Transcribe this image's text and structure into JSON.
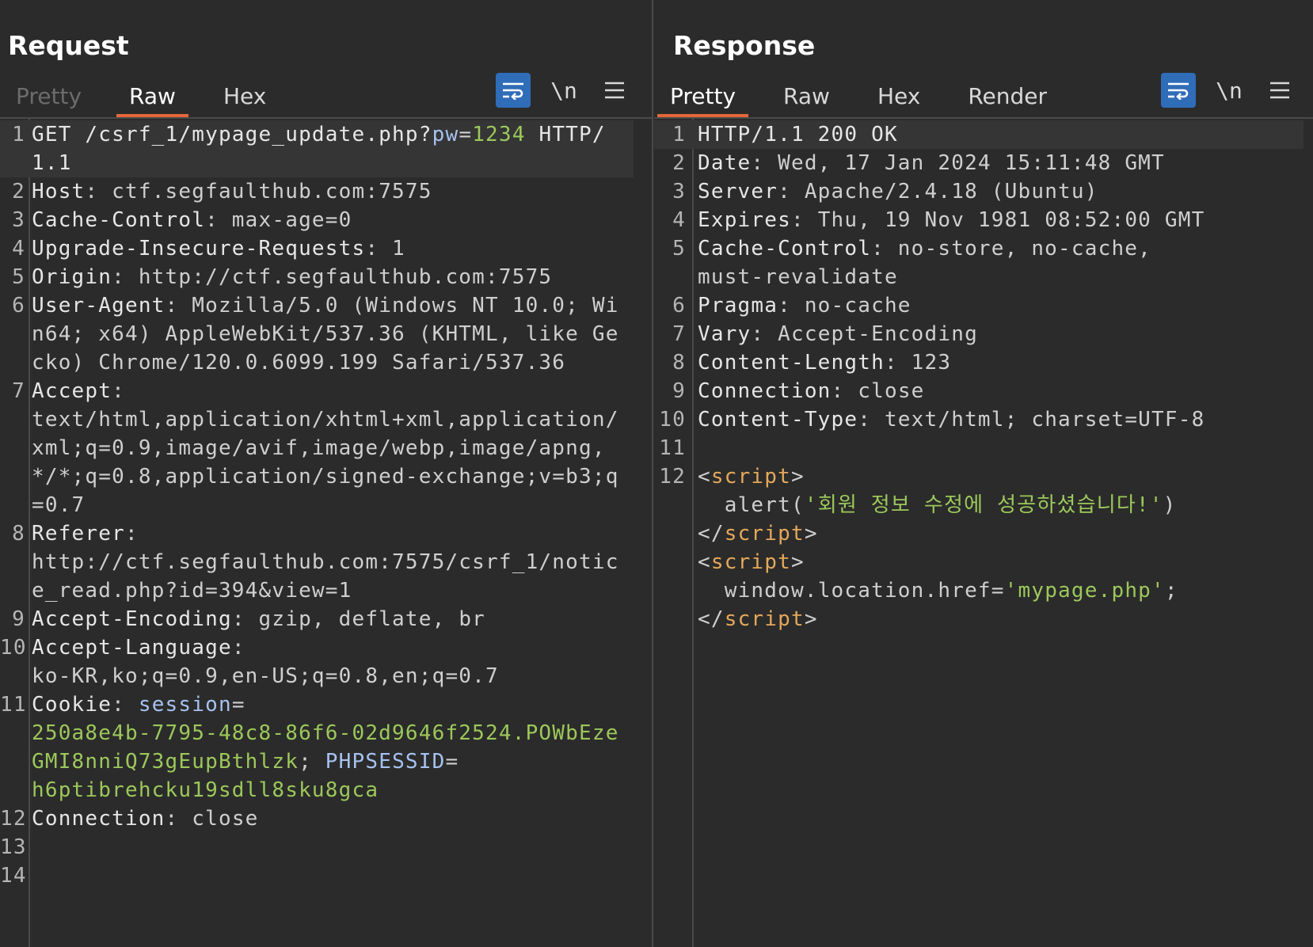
{
  "request": {
    "title": "Request",
    "tabs": [
      "Pretty",
      "Raw",
      "Hex"
    ],
    "active_tab": "Raw",
    "tools": {
      "wrap": "wrap-icon",
      "newline": "\\n",
      "menu": "menu-icon"
    },
    "lines": [
      {
        "n": "1",
        "parts": [
          [
            "k",
            "GET /csrf_1/mypage_update.php?"
          ],
          [
            "param",
            "pw"
          ],
          [
            "p",
            "="
          ],
          [
            "num",
            "1234"
          ],
          [
            "k",
            " HTTP/1.1"
          ]
        ]
      },
      {
        "n": "2",
        "parts": [
          [
            "k",
            "Host"
          ],
          [
            "p",
            ": ctf.segfaulthub.com:7575"
          ]
        ]
      },
      {
        "n": "3",
        "parts": [
          [
            "k",
            "Cache-Control"
          ],
          [
            "p",
            ": max-age=0"
          ]
        ]
      },
      {
        "n": "4",
        "parts": [
          [
            "k",
            "Upgrade-Insecure-Requests"
          ],
          [
            "p",
            ": 1"
          ]
        ]
      },
      {
        "n": "5",
        "parts": [
          [
            "k",
            "Origin"
          ],
          [
            "p",
            ": http://ctf.segfaulthub.com:7575"
          ]
        ]
      },
      {
        "n": "6",
        "parts": [
          [
            "k",
            "User-Agent"
          ],
          [
            "p",
            ": Mozilla/5.0 (Windows NT 10.0; Win64; x64) AppleWebKit/537.36 (KHTML, like Gecko) Chrome/120.0.6099.199 Safari/537.36"
          ]
        ]
      },
      {
        "n": "7",
        "parts": [
          [
            "k",
            "Accept"
          ],
          [
            "p",
            ":\ntext/html,application/xhtml+xml,application/xml;q=0.9,image/avif,image/webp,image/apng,*/*;q=0.8,application/signed-exchange;v=b3;q=0.7"
          ]
        ]
      },
      {
        "n": "8",
        "parts": [
          [
            "k",
            "Referer"
          ],
          [
            "p",
            ":\nhttp://ctf.segfaulthub.com:7575/csrf_1/notice_read.php?id=394&view=1"
          ]
        ]
      },
      {
        "n": "9",
        "parts": [
          [
            "k",
            "Accept-Encoding"
          ],
          [
            "p",
            ": gzip, deflate, br"
          ]
        ]
      },
      {
        "n": "10",
        "parts": [
          [
            "k",
            "Accept-Language"
          ],
          [
            "p",
            ":\nko-KR,ko;q=0.9,en-US;q=0.8,en;q=0.7"
          ]
        ]
      },
      {
        "n": "11",
        "parts": [
          [
            "k",
            "Cookie"
          ],
          [
            "p",
            ": "
          ],
          [
            "param",
            "session"
          ],
          [
            "p",
            "=\n"
          ],
          [
            "grn",
            "250a8e4b-7795-48c8-86f6-02d9646f2524.POWbEzeGMI8nniQ73gEupBthlzk"
          ],
          [
            "p",
            "; "
          ],
          [
            "param",
            "PHPSESSID"
          ],
          [
            "p",
            "=\n"
          ],
          [
            "grn",
            "h6ptibrehcku19sdll8sku8gca"
          ]
        ]
      },
      {
        "n": "12",
        "parts": [
          [
            "k",
            "Connection"
          ],
          [
            "p",
            ": close"
          ]
        ]
      },
      {
        "n": "13",
        "parts": []
      },
      {
        "n": "14",
        "parts": []
      }
    ]
  },
  "response": {
    "title": "Response",
    "tabs": [
      "Pretty",
      "Raw",
      "Hex",
      "Render"
    ],
    "active_tab": "Pretty",
    "tools": {
      "wrap": "wrap-icon",
      "newline": "\\n",
      "menu": "menu-icon"
    },
    "lines": [
      {
        "n": "1",
        "parts": [
          [
            "k",
            "HTTP/1.1 200 OK"
          ]
        ]
      },
      {
        "n": "2",
        "parts": [
          [
            "k",
            "Date"
          ],
          [
            "p",
            ": Wed, 17 Jan 2024 15:11:48 GMT"
          ]
        ]
      },
      {
        "n": "3",
        "parts": [
          [
            "k",
            "Server"
          ],
          [
            "p",
            ": Apache/2.4.18 (Ubuntu)"
          ]
        ]
      },
      {
        "n": "4",
        "parts": [
          [
            "k",
            "Expires"
          ],
          [
            "p",
            ": Thu, 19 Nov 1981 08:52:00 GMT"
          ]
        ]
      },
      {
        "n": "5",
        "parts": [
          [
            "k",
            "Cache-Control"
          ],
          [
            "p",
            ": no-store, no-cache,\nmust-revalidate"
          ]
        ]
      },
      {
        "n": "6",
        "parts": [
          [
            "k",
            "Pragma"
          ],
          [
            "p",
            ": no-cache"
          ]
        ]
      },
      {
        "n": "7",
        "parts": [
          [
            "k",
            "Vary"
          ],
          [
            "p",
            ": Accept-Encoding"
          ]
        ]
      },
      {
        "n": "8",
        "parts": [
          [
            "k",
            "Content-Length"
          ],
          [
            "p",
            ": 123"
          ]
        ]
      },
      {
        "n": "9",
        "parts": [
          [
            "k",
            "Connection"
          ],
          [
            "p",
            ": close"
          ]
        ]
      },
      {
        "n": "10",
        "parts": [
          [
            "k",
            "Content-Type"
          ],
          [
            "p",
            ": text/html; charset=UTF-8"
          ]
        ]
      },
      {
        "n": "11",
        "parts": []
      },
      {
        "n": "12",
        "parts": [
          [
            "p",
            "<"
          ],
          [
            "tag",
            "script"
          ],
          [
            "p",
            ">\n  alert("
          ],
          [
            "grn",
            "'회원 정보 수정에 성공하셨습니다!'"
          ],
          [
            "p",
            ")\n</"
          ],
          [
            "tag",
            "script"
          ],
          [
            "p",
            ">\n<"
          ],
          [
            "tag",
            "script"
          ],
          [
            "p",
            ">\n  window.location.href="
          ],
          [
            "grn",
            "'mypage.php'"
          ],
          [
            "p",
            ";\n</"
          ],
          [
            "tag",
            "script"
          ],
          [
            "p",
            ">"
          ]
        ]
      }
    ]
  },
  "layout_toggle": [
    "split-vertical-icon",
    "split-horizontal-icon",
    "single-pane-icon"
  ]
}
